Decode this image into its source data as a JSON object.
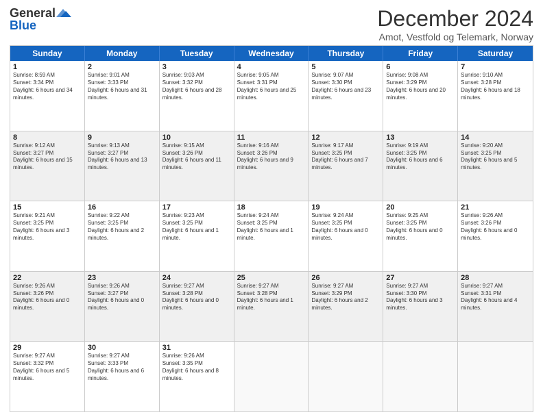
{
  "logo": {
    "general": "General",
    "blue": "Blue"
  },
  "title": "December 2024",
  "subtitle": "Amot, Vestfold og Telemark, Norway",
  "days": [
    "Sunday",
    "Monday",
    "Tuesday",
    "Wednesday",
    "Thursday",
    "Friday",
    "Saturday"
  ],
  "weeks": [
    [
      {
        "day": "1",
        "sunrise": "Sunrise: 8:59 AM",
        "sunset": "Sunset: 3:34 PM",
        "daylight": "Daylight: 6 hours and 34 minutes."
      },
      {
        "day": "2",
        "sunrise": "Sunrise: 9:01 AM",
        "sunset": "Sunset: 3:33 PM",
        "daylight": "Daylight: 6 hours and 31 minutes."
      },
      {
        "day": "3",
        "sunrise": "Sunrise: 9:03 AM",
        "sunset": "Sunset: 3:32 PM",
        "daylight": "Daylight: 6 hours and 28 minutes."
      },
      {
        "day": "4",
        "sunrise": "Sunrise: 9:05 AM",
        "sunset": "Sunset: 3:31 PM",
        "daylight": "Daylight: 6 hours and 25 minutes."
      },
      {
        "day": "5",
        "sunrise": "Sunrise: 9:07 AM",
        "sunset": "Sunset: 3:30 PM",
        "daylight": "Daylight: 6 hours and 23 minutes."
      },
      {
        "day": "6",
        "sunrise": "Sunrise: 9:08 AM",
        "sunset": "Sunset: 3:29 PM",
        "daylight": "Daylight: 6 hours and 20 minutes."
      },
      {
        "day": "7",
        "sunrise": "Sunrise: 9:10 AM",
        "sunset": "Sunset: 3:28 PM",
        "daylight": "Daylight: 6 hours and 18 minutes."
      }
    ],
    [
      {
        "day": "8",
        "sunrise": "Sunrise: 9:12 AM",
        "sunset": "Sunset: 3:27 PM",
        "daylight": "Daylight: 6 hours and 15 minutes."
      },
      {
        "day": "9",
        "sunrise": "Sunrise: 9:13 AM",
        "sunset": "Sunset: 3:27 PM",
        "daylight": "Daylight: 6 hours and 13 minutes."
      },
      {
        "day": "10",
        "sunrise": "Sunrise: 9:15 AM",
        "sunset": "Sunset: 3:26 PM",
        "daylight": "Daylight: 6 hours and 11 minutes."
      },
      {
        "day": "11",
        "sunrise": "Sunrise: 9:16 AM",
        "sunset": "Sunset: 3:26 PM",
        "daylight": "Daylight: 6 hours and 9 minutes."
      },
      {
        "day": "12",
        "sunrise": "Sunrise: 9:17 AM",
        "sunset": "Sunset: 3:25 PM",
        "daylight": "Daylight: 6 hours and 7 minutes."
      },
      {
        "day": "13",
        "sunrise": "Sunrise: 9:19 AM",
        "sunset": "Sunset: 3:25 PM",
        "daylight": "Daylight: 6 hours and 6 minutes."
      },
      {
        "day": "14",
        "sunrise": "Sunrise: 9:20 AM",
        "sunset": "Sunset: 3:25 PM",
        "daylight": "Daylight: 6 hours and 5 minutes."
      }
    ],
    [
      {
        "day": "15",
        "sunrise": "Sunrise: 9:21 AM",
        "sunset": "Sunset: 3:25 PM",
        "daylight": "Daylight: 6 hours and 3 minutes."
      },
      {
        "day": "16",
        "sunrise": "Sunrise: 9:22 AM",
        "sunset": "Sunset: 3:25 PM",
        "daylight": "Daylight: 6 hours and 2 minutes."
      },
      {
        "day": "17",
        "sunrise": "Sunrise: 9:23 AM",
        "sunset": "Sunset: 3:25 PM",
        "daylight": "Daylight: 6 hours and 1 minute."
      },
      {
        "day": "18",
        "sunrise": "Sunrise: 9:24 AM",
        "sunset": "Sunset: 3:25 PM",
        "daylight": "Daylight: 6 hours and 1 minute."
      },
      {
        "day": "19",
        "sunrise": "Sunrise: 9:24 AM",
        "sunset": "Sunset: 3:25 PM",
        "daylight": "Daylight: 6 hours and 0 minutes."
      },
      {
        "day": "20",
        "sunrise": "Sunrise: 9:25 AM",
        "sunset": "Sunset: 3:25 PM",
        "daylight": "Daylight: 6 hours and 0 minutes."
      },
      {
        "day": "21",
        "sunrise": "Sunrise: 9:26 AM",
        "sunset": "Sunset: 3:26 PM",
        "daylight": "Daylight: 6 hours and 0 minutes."
      }
    ],
    [
      {
        "day": "22",
        "sunrise": "Sunrise: 9:26 AM",
        "sunset": "Sunset: 3:26 PM",
        "daylight": "Daylight: 6 hours and 0 minutes."
      },
      {
        "day": "23",
        "sunrise": "Sunrise: 9:26 AM",
        "sunset": "Sunset: 3:27 PM",
        "daylight": "Daylight: 6 hours and 0 minutes."
      },
      {
        "day": "24",
        "sunrise": "Sunrise: 9:27 AM",
        "sunset": "Sunset: 3:28 PM",
        "daylight": "Daylight: 6 hours and 0 minutes."
      },
      {
        "day": "25",
        "sunrise": "Sunrise: 9:27 AM",
        "sunset": "Sunset: 3:28 PM",
        "daylight": "Daylight: 6 hours and 1 minute."
      },
      {
        "day": "26",
        "sunrise": "Sunrise: 9:27 AM",
        "sunset": "Sunset: 3:29 PM",
        "daylight": "Daylight: 6 hours and 2 minutes."
      },
      {
        "day": "27",
        "sunrise": "Sunrise: 9:27 AM",
        "sunset": "Sunset: 3:30 PM",
        "daylight": "Daylight: 6 hours and 3 minutes."
      },
      {
        "day": "28",
        "sunrise": "Sunrise: 9:27 AM",
        "sunset": "Sunset: 3:31 PM",
        "daylight": "Daylight: 6 hours and 4 minutes."
      }
    ],
    [
      {
        "day": "29",
        "sunrise": "Sunrise: 9:27 AM",
        "sunset": "Sunset: 3:32 PM",
        "daylight": "Daylight: 6 hours and 5 minutes."
      },
      {
        "day": "30",
        "sunrise": "Sunrise: 9:27 AM",
        "sunset": "Sunset: 3:33 PM",
        "daylight": "Daylight: 6 hours and 6 minutes."
      },
      {
        "day": "31",
        "sunrise": "Sunrise: 9:26 AM",
        "sunset": "Sunset: 3:35 PM",
        "daylight": "Daylight: 6 hours and 8 minutes."
      },
      null,
      null,
      null,
      null
    ]
  ]
}
